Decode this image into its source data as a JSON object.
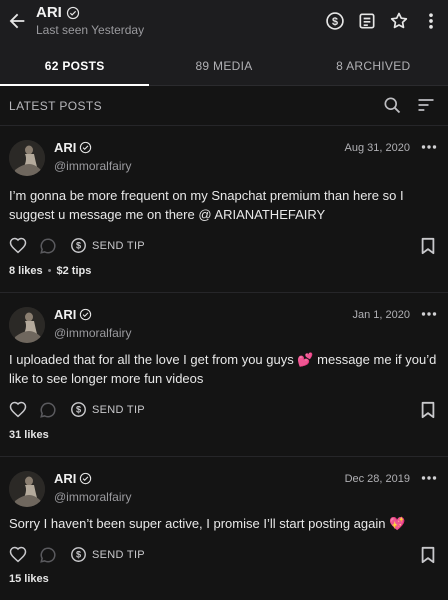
{
  "header": {
    "name": "ARI",
    "status": "Last seen Yesterday"
  },
  "tabs": [
    {
      "label": "62 POSTS",
      "active": true
    },
    {
      "label": "89 MEDIA",
      "active": false
    },
    {
      "label": "8 ARCHIVED",
      "active": false
    }
  ],
  "section": {
    "title": "LATEST POSTS"
  },
  "posts": [
    {
      "name": "ARI",
      "handle": "@immoralfairy",
      "date": "Aug 31, 2020",
      "text": "I’m gonna be more frequent on my Snapchat premium than here so I suggest u message me on there @ ARIANATHEFAIRY",
      "tip_label": "SEND TIP",
      "likes": "8 likes",
      "tips": "$2 tips"
    },
    {
      "name": "ARI",
      "handle": "@immoralfairy",
      "date": "Jan 1, 2020",
      "text": "I uploaded that for all the love I get from you guys 💕 message me if you’d like to see longer more fun videos",
      "tip_label": "SEND TIP",
      "likes": "31 likes"
    },
    {
      "name": "ARI",
      "handle": "@immoralfairy",
      "date": "Dec 28, 2019",
      "text": "Sorry I haven’t been super active, I promise I’ll start posting again 💖",
      "tip_label": "SEND TIP",
      "likes": "15 likes"
    }
  ],
  "colors": {
    "background": "#141414",
    "bar": "#1d1d1f",
    "text": "#e6e6e6",
    "muted": "#9a9a9e"
  },
  "icons": [
    "back-arrow-icon",
    "verified-icon",
    "dollar-circle-icon",
    "note-icon",
    "star-icon",
    "more-vertical-icon",
    "search-icon",
    "sort-icon",
    "avatar",
    "more-horizontal-icon",
    "heart-icon",
    "comment-icon",
    "bookmark-icon"
  ]
}
